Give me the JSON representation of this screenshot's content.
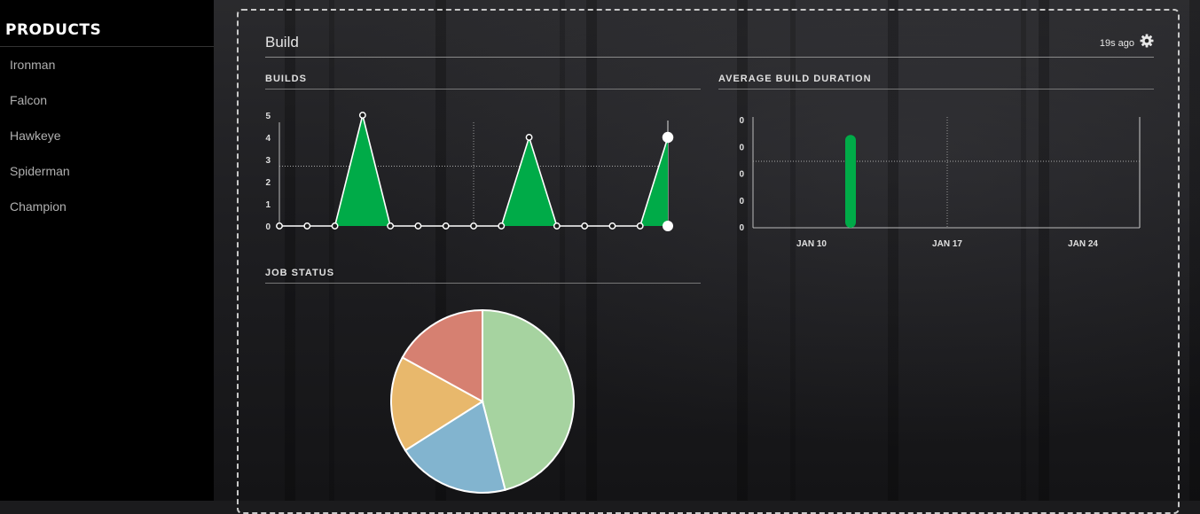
{
  "sidebar": {
    "title": "PRODUCTS",
    "items": [
      {
        "label": "Ironman"
      },
      {
        "label": "Falcon"
      },
      {
        "label": "Hawkeye"
      },
      {
        "label": "Spiderman"
      },
      {
        "label": "Champion"
      }
    ]
  },
  "panel": {
    "title": "Build",
    "updated": "19s ago",
    "settings_icon": "gear-icon"
  },
  "widgets": {
    "builds": {
      "title": "BUILDS"
    },
    "avg_duration": {
      "title": "AVERAGE BUILD DURATION"
    },
    "job_status": {
      "title": "JOB STATUS"
    }
  },
  "colors": {
    "accent_green": "#00ab48",
    "pie_green": "#a6d3a0",
    "pie_blue": "#82b4cf",
    "pie_orange": "#e8b86c",
    "pie_red": "#d68071"
  },
  "chart_data": [
    {
      "type": "area",
      "title": "BUILDS",
      "y_ticks": [
        "0",
        "1",
        "2",
        "3",
        "4",
        "5"
      ],
      "ylim": [
        0,
        5
      ],
      "x": [
        0,
        1,
        2,
        3,
        4,
        5,
        6,
        7,
        8,
        9,
        10,
        11,
        12,
        13,
        14
      ],
      "values": [
        0,
        0,
        0,
        5,
        0,
        0,
        0,
        0,
        0,
        4,
        0,
        0,
        0,
        0,
        4
      ],
      "highlight_last": true,
      "average_line": 2.7,
      "vertical_gridlines": [
        7,
        14
      ]
    },
    {
      "type": "bar",
      "title": "AVERAGE BUILD DURATION",
      "y_ticks": [
        "0",
        "0",
        "0",
        "0",
        "0"
      ],
      "x_ticks": [
        "JAN 10",
        "JAN 17",
        "JAN 24"
      ],
      "bars": [
        {
          "date": "JAN 12",
          "value": 0.88
        }
      ],
      "ylim": [
        0,
        1
      ],
      "average_line": 0.63
    },
    {
      "type": "pie",
      "title": "JOB STATUS",
      "slices": [
        {
          "value": 46,
          "color": "#a6d3a0"
        },
        {
          "value": 20,
          "color": "#82b4cf"
        },
        {
          "value": 17,
          "color": "#e8b86c"
        },
        {
          "value": 17,
          "color": "#d68071"
        }
      ]
    }
  ]
}
